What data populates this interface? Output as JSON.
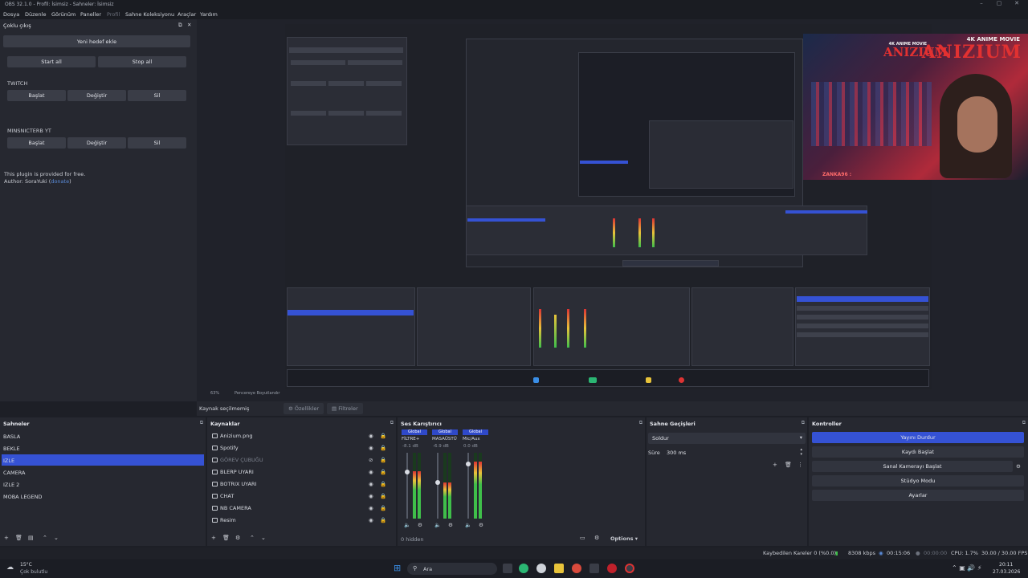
{
  "window": {
    "title": "OBS 32.1.0 - Profil: İsimsiz - Sahneler: İsimsiz"
  },
  "menu": {
    "items": [
      "Dosya",
      "Düzenle",
      "Görünüm",
      "Paneller",
      "Profil",
      "Sahne Koleksiyonu",
      "Araçlar",
      "Yardım"
    ]
  },
  "multi_output": {
    "title": "Çoklu çıkış",
    "add_target": "Yeni hedef ekle",
    "start_all": "Start all",
    "stop_all": "Stop all",
    "targets": [
      {
        "name": "TWITCH",
        "start": "Başlat",
        "edit": "Değiştir",
        "delete": "Sil"
      },
      {
        "name": "MINSNICTERB YT",
        "start": "Başlat",
        "edit": "Değiştir",
        "delete": "Sil"
      }
    ],
    "note": "This plugin is provided for free.",
    "author_prefix": "Author: SoraYuki (",
    "author_link": "donate",
    "author_suffix": ")"
  },
  "webcam_overlay": {
    "brand_small": "ANIZIUM",
    "brand_large": "ANIZIUM",
    "tag_large": "4K ANIME MOVIE",
    "tag_small": "4K ANIME MOVIE",
    "chat_line": "ZANKA96 :"
  },
  "preview_status": {
    "zoom": "63%",
    "fit": "Pencereye Boyutlandır"
  },
  "toolbar": {
    "no_source": "Kaynak seçilmemiş",
    "properties": "Özellikler",
    "filters": "Filtreler"
  },
  "scenes": {
    "title": "Sahneler",
    "items": [
      "BASLA",
      "BEKLE",
      "IZLE",
      "CAMERA",
      "IZLE 2",
      "MOBA LEGEND"
    ],
    "selected_index": 2
  },
  "sources": {
    "title": "Kaynaklar",
    "items": [
      {
        "name": "Anizium.png",
        "dim": false
      },
      {
        "name": "Spotify",
        "dim": false
      },
      {
        "name": "GÖREV ÇUBUĞU",
        "dim": true
      },
      {
        "name": "BLERP UYARI",
        "dim": false
      },
      {
        "name": "BOTRIX UYARI",
        "dim": false
      },
      {
        "name": "CHAT",
        "dim": false
      },
      {
        "name": "NB CAMERA",
        "dim": false
      },
      {
        "name": "Resim",
        "dim": false
      }
    ]
  },
  "mixer": {
    "title": "Ses Karıştırıcı",
    "channels": [
      {
        "badge": "Global",
        "name": "FİLTRE+",
        "db": "-8.1 dB",
        "level": 0.72
      },
      {
        "badge": "Global",
        "name": "MASAÜSTÜ",
        "db": "-6.9 dB",
        "level": 0.55
      },
      {
        "badge": "Global",
        "name": "Mic/Aux",
        "db": "0.0 dB",
        "level": 0.86
      }
    ],
    "hidden": "0 hidden",
    "options": "Options"
  },
  "transitions": {
    "title": "Sahne Geçişleri",
    "current": "Soldur",
    "duration_label": "Süre",
    "duration_value": "300 ms"
  },
  "controls": {
    "title": "Kontroller",
    "buttons": [
      "Yayını Durdur",
      "Kaydı Başlat",
      "Sanal Kamerayı Başlat",
      "Stüdyo Modu",
      "Ayarlar"
    ]
  },
  "status": {
    "dropped": "Kaybedilen Kareler 0 (%0.0)",
    "bitrate": "8308 kbps",
    "stream_time": "00:15:06",
    "rec_time": "00:00:00",
    "cpu": "CPU: 1.7%",
    "fps": "30.00 / 30.00 FPS"
  },
  "taskbar": {
    "weather_temp": "15°C",
    "weather_desc": "Çok bulutlu",
    "search": "Ara",
    "time": "20:11",
    "date": "27.03.2026"
  },
  "colors": {
    "accent": "#3552d4",
    "panel": "#262830",
    "background": "#1d1f26"
  }
}
